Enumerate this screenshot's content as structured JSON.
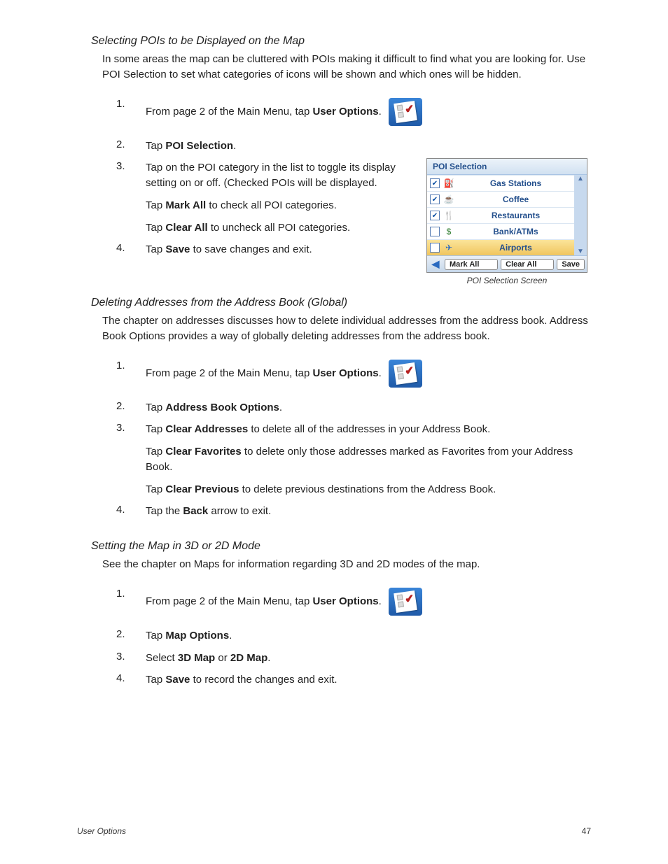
{
  "sec1": {
    "heading": "Selecting POIs to be Displayed on the Map",
    "intro": "In some areas the map can be cluttered with POIs making it difficult to find what you are looking for.  Use POI Selection to set what categories of icons will be shown and which ones will be hidden.",
    "step1_pre": "From page 2 of the Main Menu, tap ",
    "step1_b": "User Options",
    "step2_pre": "Tap ",
    "step2_b": "POI Selection",
    "step3a": "Tap on the POI category in the list to toggle its display setting on or off.  (Checked POIs will be displayed.",
    "step3b_pre": "Tap ",
    "step3b_b": "Mark All",
    "step3b_post": " to check all POI categories.",
    "step3c_pre": "Tap ",
    "step3c_b": "Clear All",
    "step3c_post": " to uncheck all POI categories.",
    "step4_pre": "Tap ",
    "step4_b": "Save",
    "step4_post": " to save changes and exit."
  },
  "poi": {
    "title": "POI Selection",
    "rows": {
      "gas": "Gas Stations",
      "cof": "Coffee",
      "res": "Restaurants",
      "bank": "Bank/ATMs",
      "air": "Airports"
    },
    "markall": "Mark All",
    "clearall": "Clear All",
    "save": "Save",
    "caption": "POI Selection Screen"
  },
  "sec2": {
    "heading": "Deleting Addresses from the Address Book (Global)",
    "intro": "The chapter on addresses discusses how to delete individual addresses from the address book. Address Book Options provides a way of globally deleting addresses from the address book.",
    "step1_pre": "From page 2 of the Main Menu, tap ",
    "step1_b": "User Options",
    "step2_pre": "Tap ",
    "step2_b": "Address Book Options",
    "step3a_pre": "Tap ",
    "step3a_b": "Clear Addresses",
    "step3a_post": " to delete all of the addresses in your Address Book.",
    "step3b_pre": "Tap ",
    "step3b_b": "Clear Favorites",
    "step3b_post": " to delete only those addresses marked as Favorites from your Address Book.",
    "step3c_pre": "Tap ",
    "step3c_b": "Clear Previous",
    "step3c_post": " to delete previous destinations from the Address Book.",
    "step4_pre": "Tap the ",
    "step4_b": "Back",
    "step4_post": " arrow to exit."
  },
  "sec3": {
    "heading": "Setting the Map in 3D or 2D Mode",
    "intro": "See the chapter on Maps for information regarding 3D and 2D modes of the map.",
    "step1_pre": "From page 2 of the Main Menu, tap ",
    "step1_b": "User Options",
    "step2_pre": "Tap ",
    "step2_b": "Map Options",
    "step3_pre": "Select ",
    "step3_b1": "3D Map",
    "step3_mid": " or ",
    "step3_b2": "2D Map",
    "step4_pre": "Tap ",
    "step4_b": "Save",
    "step4_post": " to record the changes and exit."
  },
  "footer": {
    "section": "User Options",
    "page": "47"
  }
}
